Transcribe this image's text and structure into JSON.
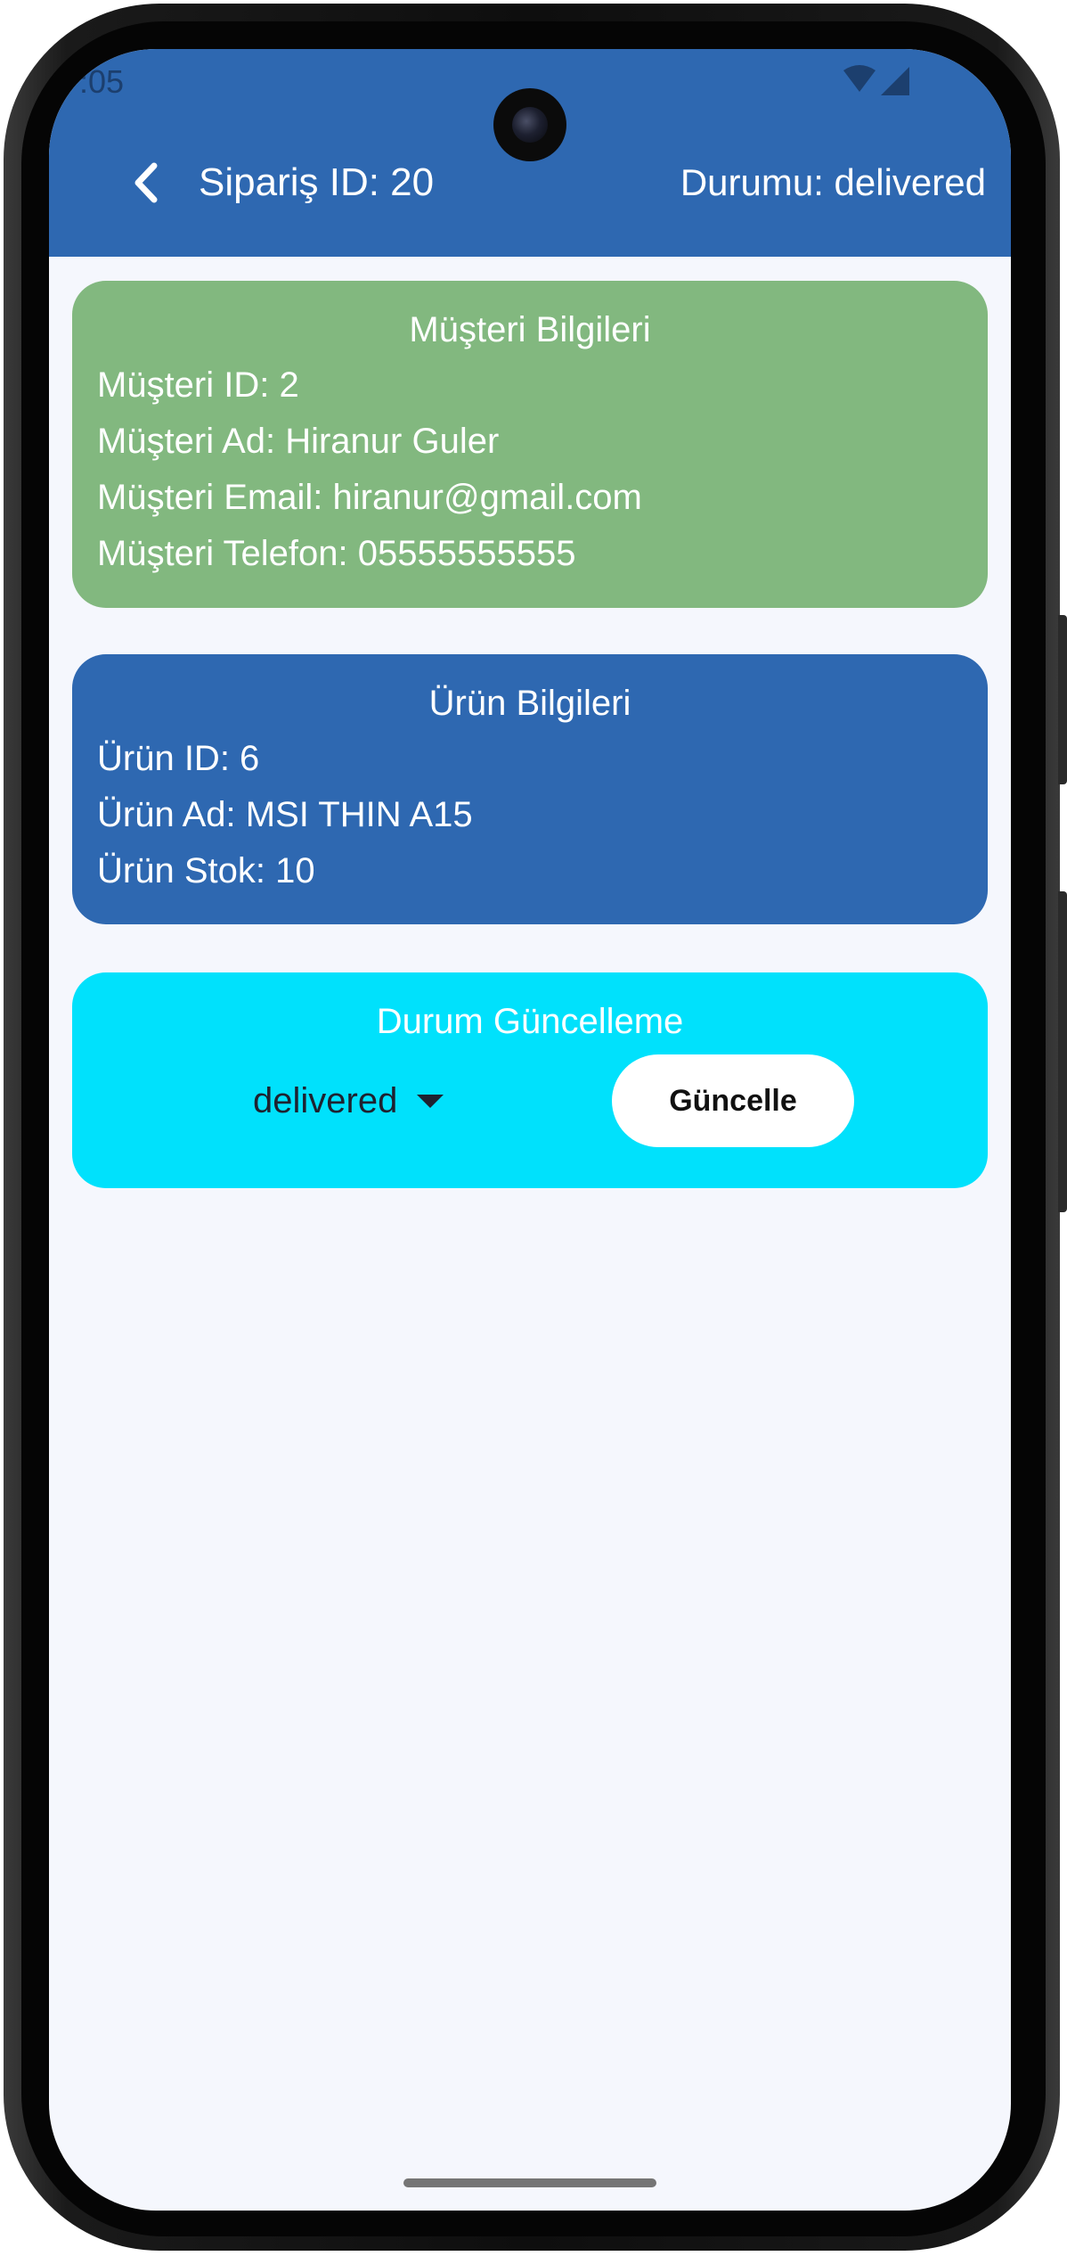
{
  "status_bar": {
    "time": ":05"
  },
  "app_bar": {
    "title": "Sipariş ID: 20",
    "status": "Durumu: delivered",
    "background": "#2e68b1"
  },
  "customer_card": {
    "title": "Müşteri Bilgileri",
    "lines": [
      "Müşteri ID: 2",
      "Müşteri Ad: Hiranur Guler",
      "Müşteri Email: hiranur@gmail.com",
      "Müşteri Telefon: 05555555555"
    ],
    "background": "#82b87f"
  },
  "product_card": {
    "title": "Ürün Bilgileri",
    "lines": [
      "Ürün ID: 6",
      "Ürün Ad: MSI THIN A15",
      "Ürün Stok: 10"
    ],
    "background": "#2e68b1"
  },
  "status_update_card": {
    "title": "Durum Güncelleme",
    "selected_status": "delivered",
    "button_label": "Güncelle",
    "background": "#00e1fc"
  },
  "icons": {
    "back": "chevron-left-icon",
    "dropdown": "triangle-down-icon",
    "wifi": "wifi-icon",
    "signal": "signal-icon"
  }
}
